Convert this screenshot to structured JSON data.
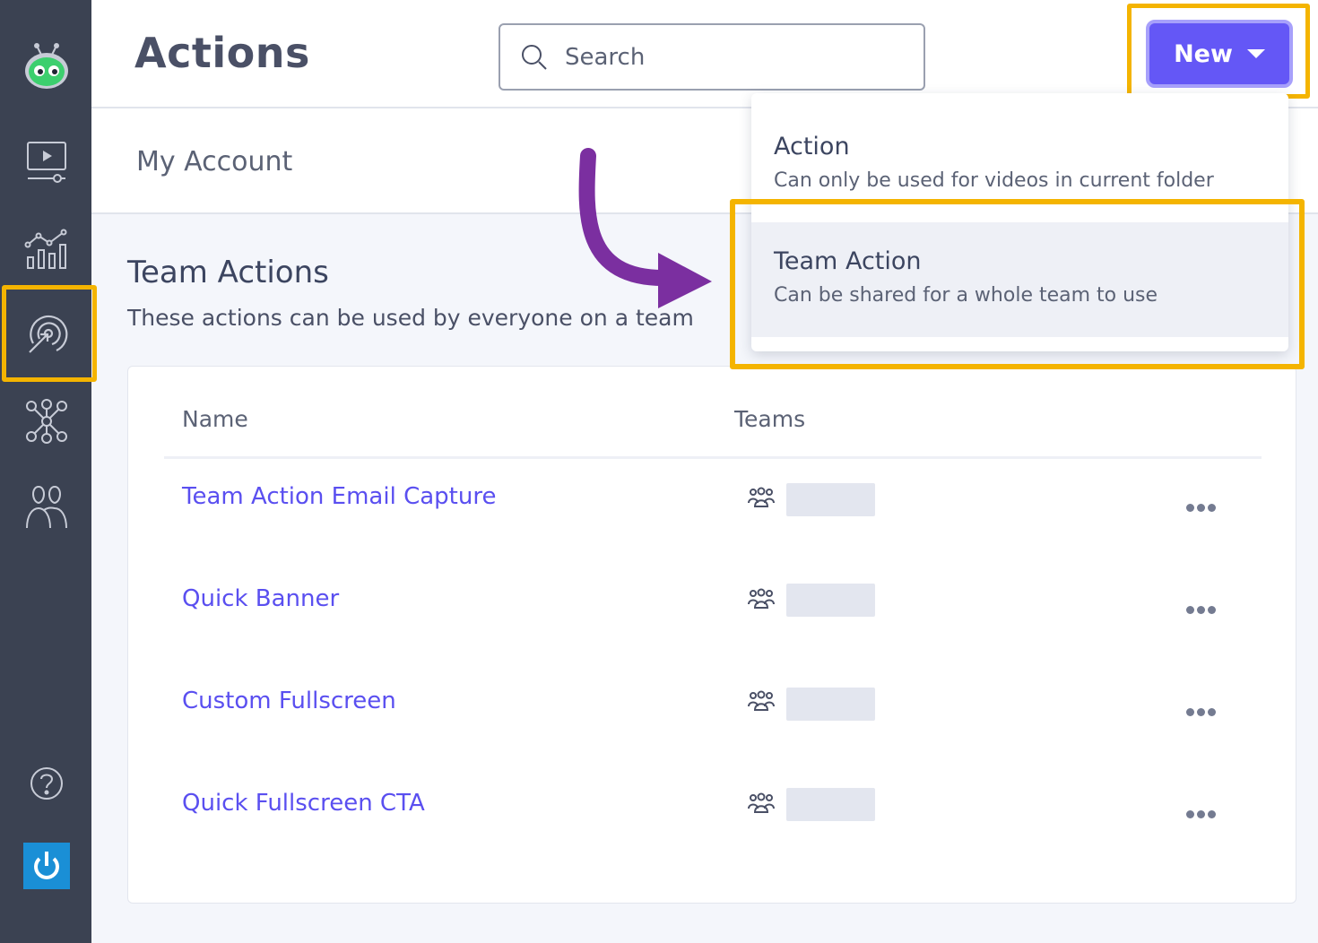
{
  "header": {
    "title": "Actions",
    "search_placeholder": "Search",
    "new_label": "New"
  },
  "subheader": {
    "account": "My Account"
  },
  "section": {
    "title": "Team Actions",
    "description": "These actions can be used by everyone on a team"
  },
  "table": {
    "columns": [
      "Name",
      "Teams"
    ],
    "rows": [
      {
        "name": "Team Action Email Capture"
      },
      {
        "name": "Quick Banner"
      },
      {
        "name": "Custom Fullscreen"
      },
      {
        "name": "Quick Fullscreen CTA"
      }
    ]
  },
  "dropdown": {
    "items": [
      {
        "title": "Action",
        "description": "Can only be used for videos in current folder"
      },
      {
        "title": "Team Action",
        "description": "Can be shared for a whole team to use"
      }
    ]
  },
  "sidebar": {
    "items": [
      "logo-robot-icon",
      "video-icon",
      "analytics-icon",
      "actions-target-icon",
      "integrations-network-icon",
      "users-icon",
      "help-icon",
      "power-icon"
    ]
  },
  "colors": {
    "sidebar_bg": "#3b4252",
    "accent": "#6457f6",
    "link": "#5a4ff0",
    "highlight": "#f4b400",
    "arrow": "#7b2fa0"
  }
}
